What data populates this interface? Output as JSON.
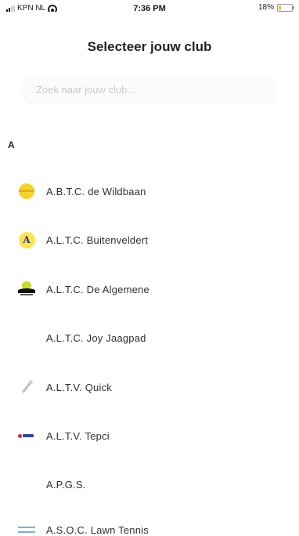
{
  "status_bar": {
    "carrier": "KPN NL",
    "time": "7:36 PM",
    "battery_percent": "18%",
    "battery_level": 0.18
  },
  "header": {
    "title": "Selecteer jouw club"
  },
  "search": {
    "placeholder": "Zoek naar jouw club...",
    "value": ""
  },
  "section": {
    "letter": "A"
  },
  "clubs": [
    {
      "name": "A.B.T.C. de Wildbaan",
      "icon": "tennis-ball-icon"
    },
    {
      "name": "A.L.T.C. Buitenveldert",
      "icon": "letter-a-logo-icon"
    },
    {
      "name": "A.L.T.C. De Algemene",
      "icon": "algemene-logo-icon"
    },
    {
      "name": "A.L.T.C. Joy Jaagpad",
      "icon": "none"
    },
    {
      "name": "A.L.T.V. Quick",
      "icon": "racket-icon"
    },
    {
      "name": "A.L.T.V. Tepci",
      "icon": "tepci-logo-icon"
    },
    {
      "name": "A.P.G.S.",
      "icon": "none"
    },
    {
      "name": "A.S.O.C. Lawn Tennis",
      "icon": "lawn-tennis-logo-icon"
    }
  ]
}
